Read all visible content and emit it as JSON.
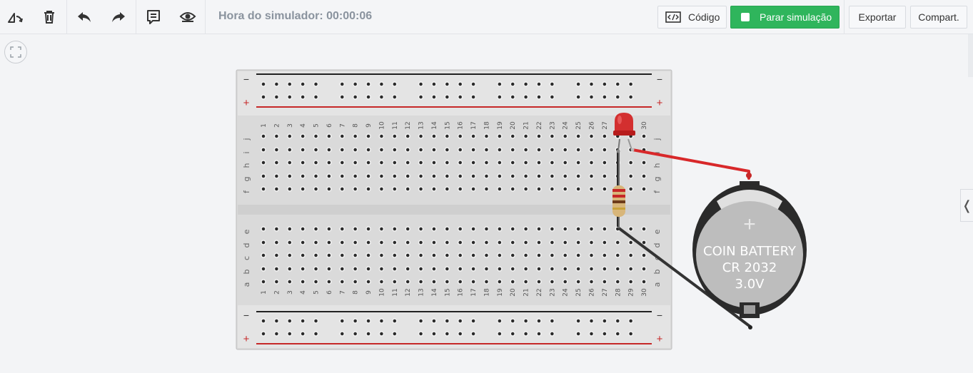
{
  "toolbar": {
    "simulator_time_label": "Hora do simulador: 00:00:06",
    "code_label": "Código",
    "stop_label": "Parar simulação",
    "export_label": "Exportar",
    "share_label": "Compart."
  },
  "icons": {
    "rotate": "rotate-icon",
    "delete": "trash-icon",
    "undo": "undo-icon",
    "redo": "redo-icon",
    "notes": "notes-icon",
    "visibility": "eye-icon",
    "code": "code-icon",
    "fit": "fit-view-icon",
    "panel": "chevron-left-icon"
  },
  "colors": {
    "stop_button": "#2fb55c",
    "red_wire": "#d8282a",
    "black_wire": "#333333",
    "led": "#d32f2f"
  },
  "breadboard": {
    "row_labels_top": [
      "j",
      "i",
      "h",
      "g",
      "f"
    ],
    "row_labels_bottom": [
      "e",
      "d",
      "c",
      "b",
      "a"
    ],
    "columns": [
      "1",
      "2",
      "3",
      "4",
      "5",
      "6",
      "7",
      "8",
      "9",
      "10",
      "11",
      "12",
      "13",
      "14",
      "15",
      "16",
      "17",
      "18",
      "19",
      "20",
      "21",
      "22",
      "23",
      "24",
      "25",
      "26",
      "27",
      "28",
      "29",
      "30"
    ],
    "rail_minus": "−",
    "rail_plus": "+"
  },
  "battery": {
    "plus_mark": "+",
    "line1": "COIN BATTERY",
    "line2": "CR 2032",
    "line3": "3.0V"
  },
  "panel_toggle_glyph": "❬"
}
